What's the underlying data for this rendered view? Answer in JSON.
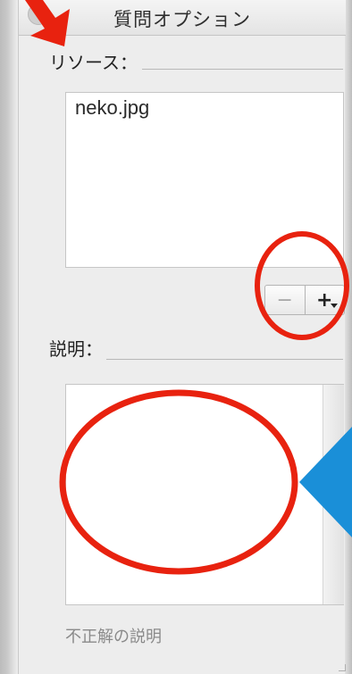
{
  "window": {
    "title": "質問オプション"
  },
  "resources": {
    "label": "リソース：",
    "items": [
      "neko.jpg"
    ],
    "remove_label": "−",
    "add_label": "+"
  },
  "description": {
    "label": "説明：",
    "value": ""
  },
  "incorrect_description": {
    "placeholder": "不正解の説明"
  },
  "annotations": {
    "highlight_color": "#e8220f",
    "pointer_color": "#1a8fd8"
  }
}
